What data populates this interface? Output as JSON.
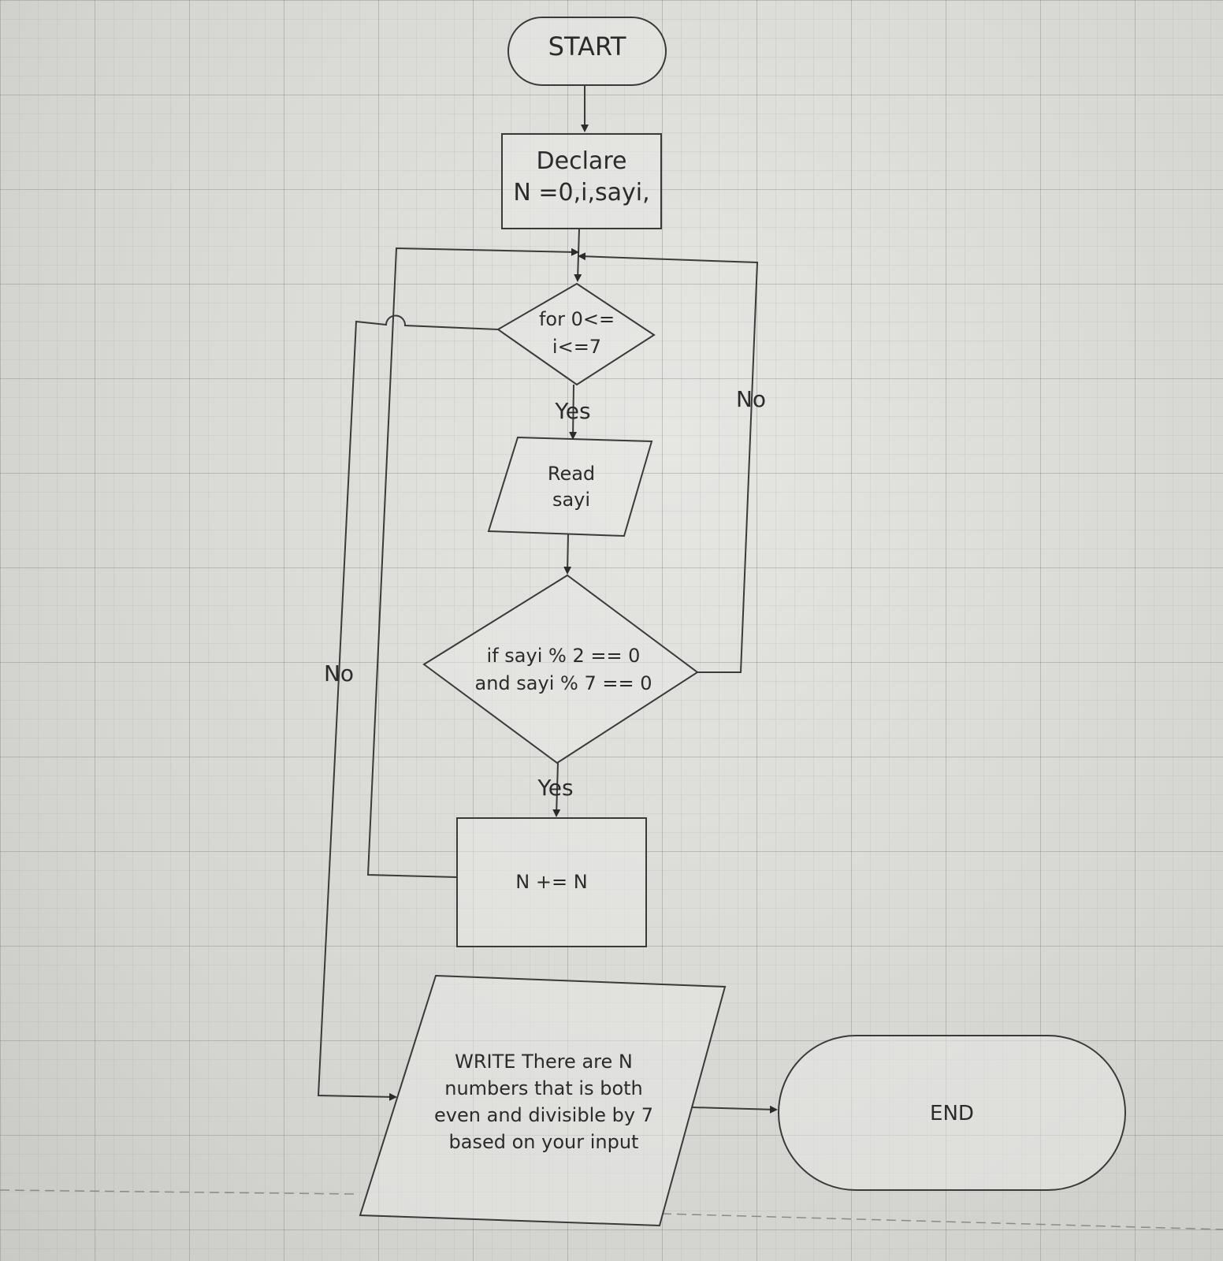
{
  "nodes": {
    "start": "START",
    "declare": [
      "Declare",
      "N =0,i,sayi,"
    ],
    "loop": [
      "for  0<=",
      "i<=7"
    ],
    "read": [
      "Read",
      "sayi"
    ],
    "condition": [
      "if sayi % 2 == 0",
      "and sayi % 7 == 0"
    ],
    "increment": "N += N",
    "write": [
      "WRITE There are N",
      "numbers that is both",
      "even and divisible by 7",
      "based on your input"
    ],
    "end": "END"
  },
  "edges": {
    "loop_yes": "Yes",
    "loop_no": "No",
    "cond_yes": "Yes",
    "cond_no": "No"
  }
}
